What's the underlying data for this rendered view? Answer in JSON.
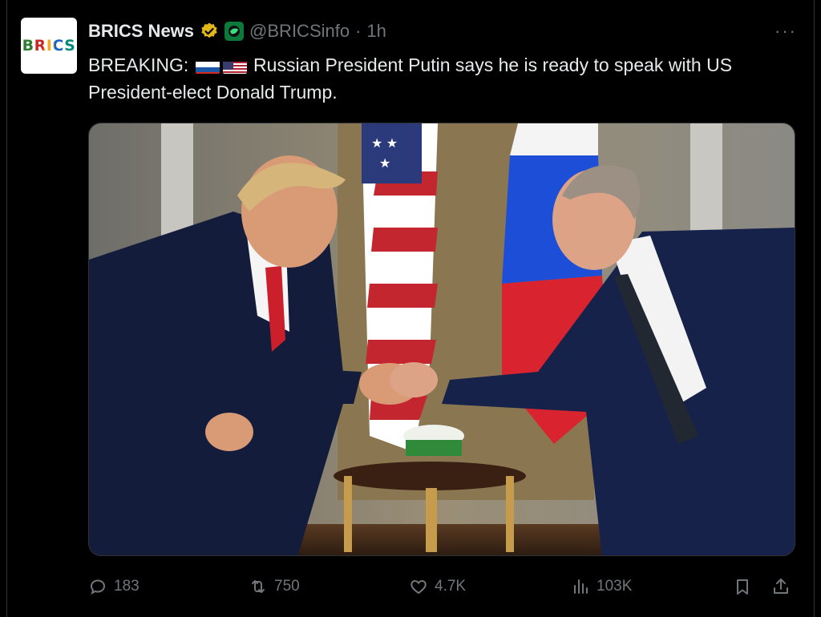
{
  "tweet": {
    "avatar_text": "BRICS",
    "display_name": "BRICS News",
    "handle": "@BRICSinfo",
    "separator": "·",
    "time": "1h",
    "more_label": "···",
    "text_prefix": "BREAKING:",
    "text_body": "Russian President Putin says he is ready to speak with US President-elect Donald Trump.",
    "flags": [
      "russia-flag",
      "usa-flag"
    ]
  },
  "actions": {
    "replies": "183",
    "reposts": "750",
    "likes": "4.7K",
    "views": "103K"
  },
  "colors": {
    "background": "#000000",
    "text": "#e7e9ea",
    "muted": "#71767b",
    "verified_gold": "#e2b719",
    "affiliate_green": "#0b7a3b"
  }
}
